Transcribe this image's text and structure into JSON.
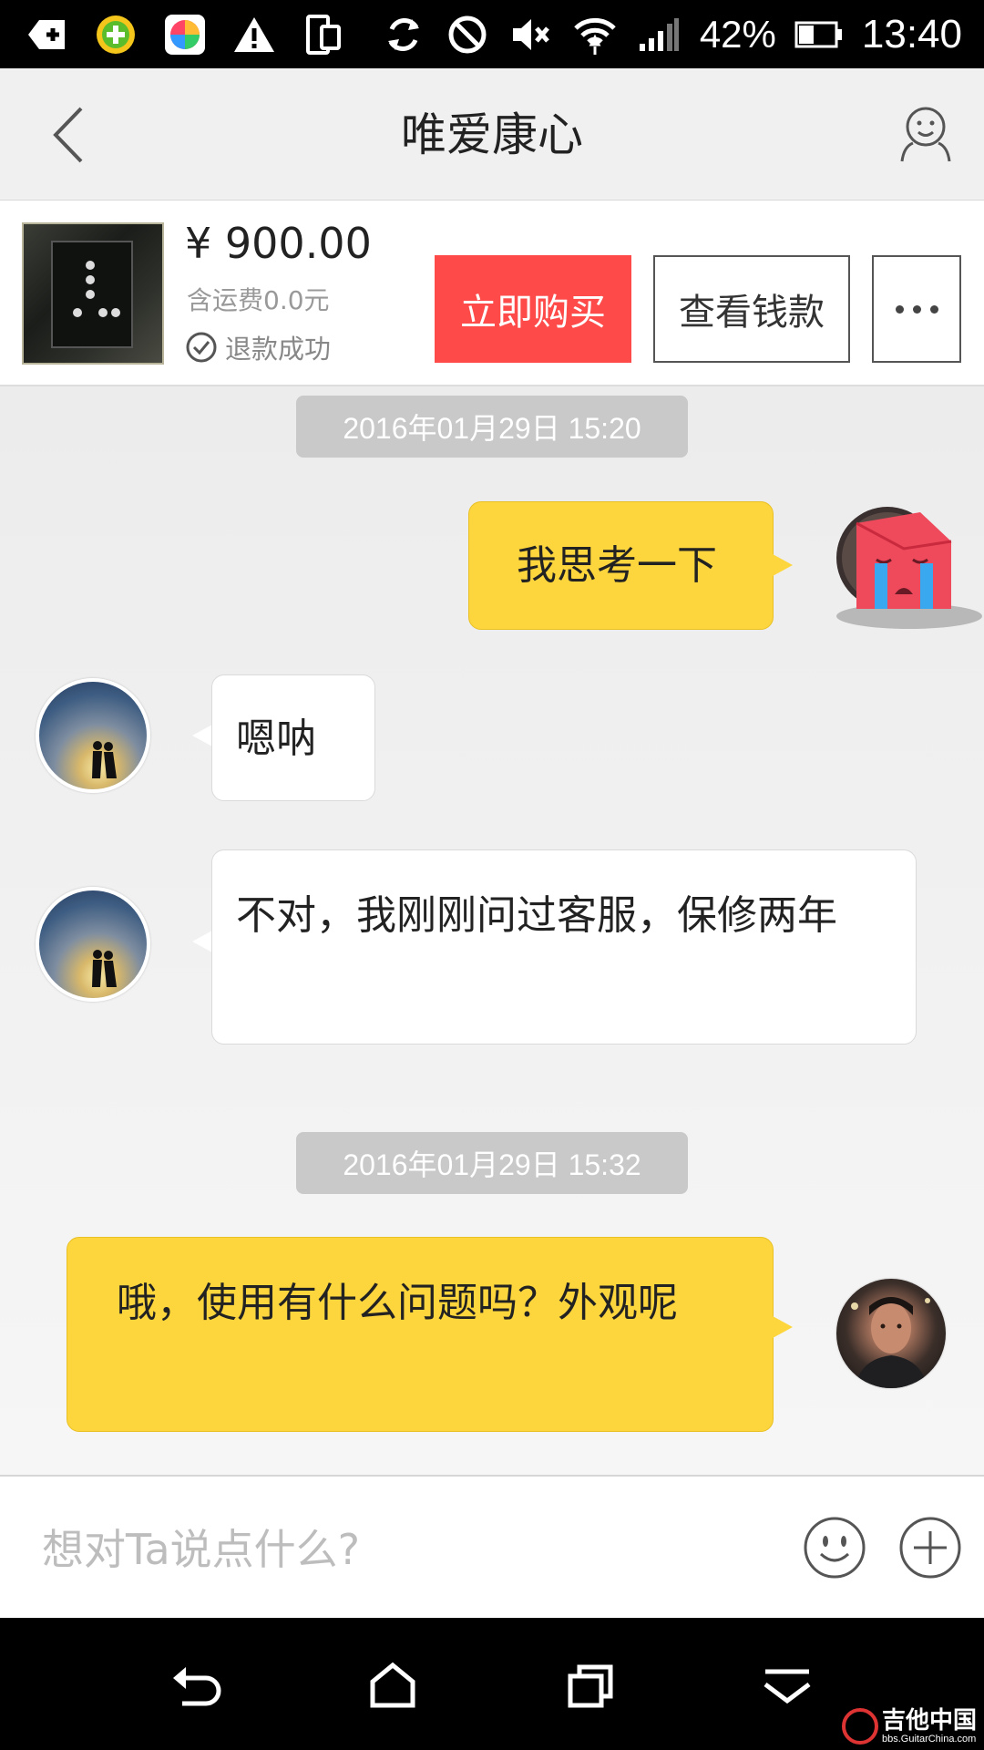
{
  "status_bar": {
    "left_icons": [
      "add-box-icon",
      "plus-ball-app-icon",
      "colorful-app-icon",
      "warning-icon",
      "screen-rotate-icon"
    ],
    "right_icons": [
      "sync-icon",
      "do-not-disturb-icon",
      "mute-icon",
      "wifi-icon",
      "signal-icon"
    ],
    "battery_percent": "42%",
    "battery_level": 0.42,
    "time": "13:40"
  },
  "header": {
    "title": "唯爱康心"
  },
  "product": {
    "price": "¥ 900.00",
    "shipping": "含运费0.0元",
    "status": "退款成功",
    "buy_label": "立即购买",
    "view_label": "查看钱款"
  },
  "chat": {
    "messages": [
      {
        "type": "timestamp",
        "text": "2016年01月29日 15:20"
      },
      {
        "type": "out",
        "avatar": "crying-face-avatar",
        "text": "我思考一下"
      },
      {
        "type": "in",
        "avatar": "sunset-couple-avatar",
        "text": "嗯呐"
      },
      {
        "type": "in",
        "avatar": "sunset-couple-avatar",
        "text": "不对，我刚刚问过客服，保修两年"
      },
      {
        "type": "timestamp",
        "text": "2016年01月29日 15:32"
      },
      {
        "type": "out",
        "avatar": "man-portrait-avatar",
        "text": "哦，使用有什么问题吗？外观呢"
      }
    ]
  },
  "input": {
    "placeholder": "想对Ta说点什么?",
    "value": ""
  },
  "nav_bar": {
    "icons": [
      "back-nav-icon",
      "home-nav-icon",
      "recent-apps-icon",
      "dropdown-nav-icon"
    ]
  },
  "watermark": {
    "main": "吉他中国",
    "sub": "bbs.GuitarChina.com"
  },
  "colors": {
    "accent_red": "#ff4a4a",
    "bubble_yellow": "#fdd63d",
    "bubble_white": "#ffffff",
    "timestamp_gray": "#c9c9c9"
  }
}
